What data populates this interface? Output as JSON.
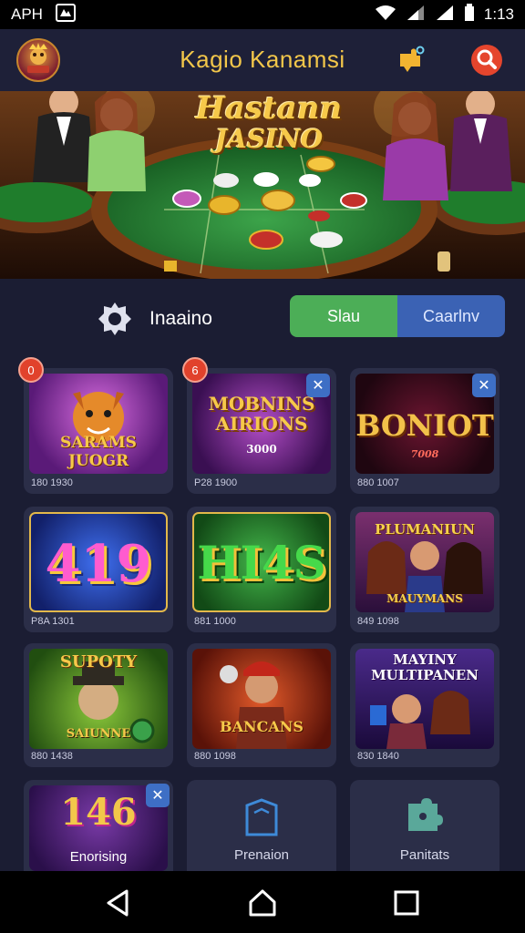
{
  "status_bar": {
    "left_text": "APH",
    "time": "1:13"
  },
  "header": {
    "title": "Kagio Kanamsi",
    "logo_icon": "casino-logo-icon",
    "right_icons": [
      "puzzle-icon",
      "search-icon"
    ],
    "accent": "#f2c64a",
    "search_color": "#e5452d"
  },
  "banner": {
    "title_line1": "Hastann",
    "title_line2": "JASINO"
  },
  "filter": {
    "label": "Inaaino",
    "icon": "gear-icon",
    "segments": [
      "Slau",
      "Caarlnv"
    ],
    "seg_colors": [
      "#4cae57",
      "#3b62b4"
    ]
  },
  "games": [
    {
      "title": "SARAMS JUOGR",
      "meta": "180 1930",
      "badge": "0",
      "badge_type": "red"
    },
    {
      "title": "MOBNINS AIRIONS",
      "sub": "3000",
      "meta": "P28 1900",
      "badge": "6",
      "badge_type": "red",
      "corner_x": true
    },
    {
      "title": "BONIOT",
      "sub": "7008",
      "meta": "880 1007",
      "corner_x": true
    },
    {
      "title": "419",
      "meta": "P8A 1301"
    },
    {
      "title": "HI4S",
      "meta": "881 1000"
    },
    {
      "title": "PLUMANIUN",
      "sub": "MAUYMANS",
      "meta": "849 1098"
    },
    {
      "title": "SUPOTY",
      "sub": "SAIUNNE",
      "meta": "880 1438"
    },
    {
      "title": "BANCANS",
      "meta": "880 1098"
    },
    {
      "title": "MAYINY MULTIPANEN",
      "meta": "830 1840"
    },
    {
      "title": "146",
      "sub": "Enorising",
      "corner_x": true
    },
    {
      "title": "Prenaion"
    },
    {
      "title": "Panitats"
    }
  ],
  "nav": [
    "back-icon",
    "home-icon",
    "recents-icon"
  ]
}
